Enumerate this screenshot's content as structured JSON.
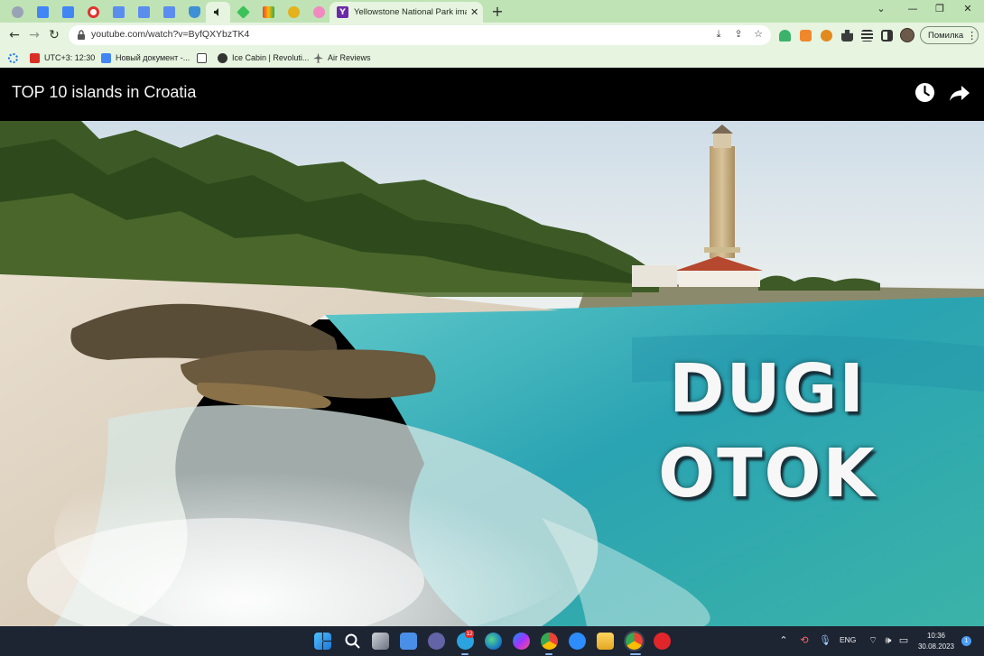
{
  "browser": {
    "active_tab": {
      "title": "Yellowstone National Park image",
      "close_glyph": "✕",
      "favicon_letter": "Y"
    },
    "new_tab_glyph": "+",
    "window_controls": {
      "dropdown": "⌄",
      "minimize": "—",
      "restore": "❐",
      "close": "✕"
    },
    "address": {
      "url": "youtube.com/watch?v=ByfQXYbzTK4"
    },
    "profile_button": {
      "label": "Помилка",
      "menu_glyph": "⋮"
    },
    "nav": {
      "back": "←",
      "forward": "→",
      "reload": "↻"
    }
  },
  "bookmarks": [
    {
      "label": "",
      "icon": "settings-gear-icon",
      "color": "#1a73e8"
    },
    {
      "label": "UTC+3: 12:30",
      "icon": "clock-bookmark-icon",
      "color": "#d93025"
    },
    {
      "label": "Новый документ -...",
      "icon": "google-docs-icon",
      "color": "#4285f4"
    },
    {
      "label": "",
      "icon": "medium-icon",
      "color": "#444444"
    },
    {
      "label": "Ice Cabin | Revoluti...",
      "icon": "globe-icon",
      "color": "#333333"
    },
    {
      "label": "Air Reviews",
      "icon": "plane-icon",
      "color": "#555555"
    }
  ],
  "video": {
    "title": "TOP 10 islands in Croatia",
    "caption_line1": "DUGI",
    "caption_line2": "OTOK"
  },
  "taskbar": {
    "language": "ENG",
    "time": "10:36",
    "date": "30.08.2023",
    "notifications": "1",
    "telegram_badge": "12"
  },
  "colors": {
    "tab_strip": "#bfe3b4",
    "toolbar": "#e6f4e0",
    "taskbar": "#1d2432",
    "sea": "#2fa7b3",
    "sky": "#d9e6ee"
  }
}
